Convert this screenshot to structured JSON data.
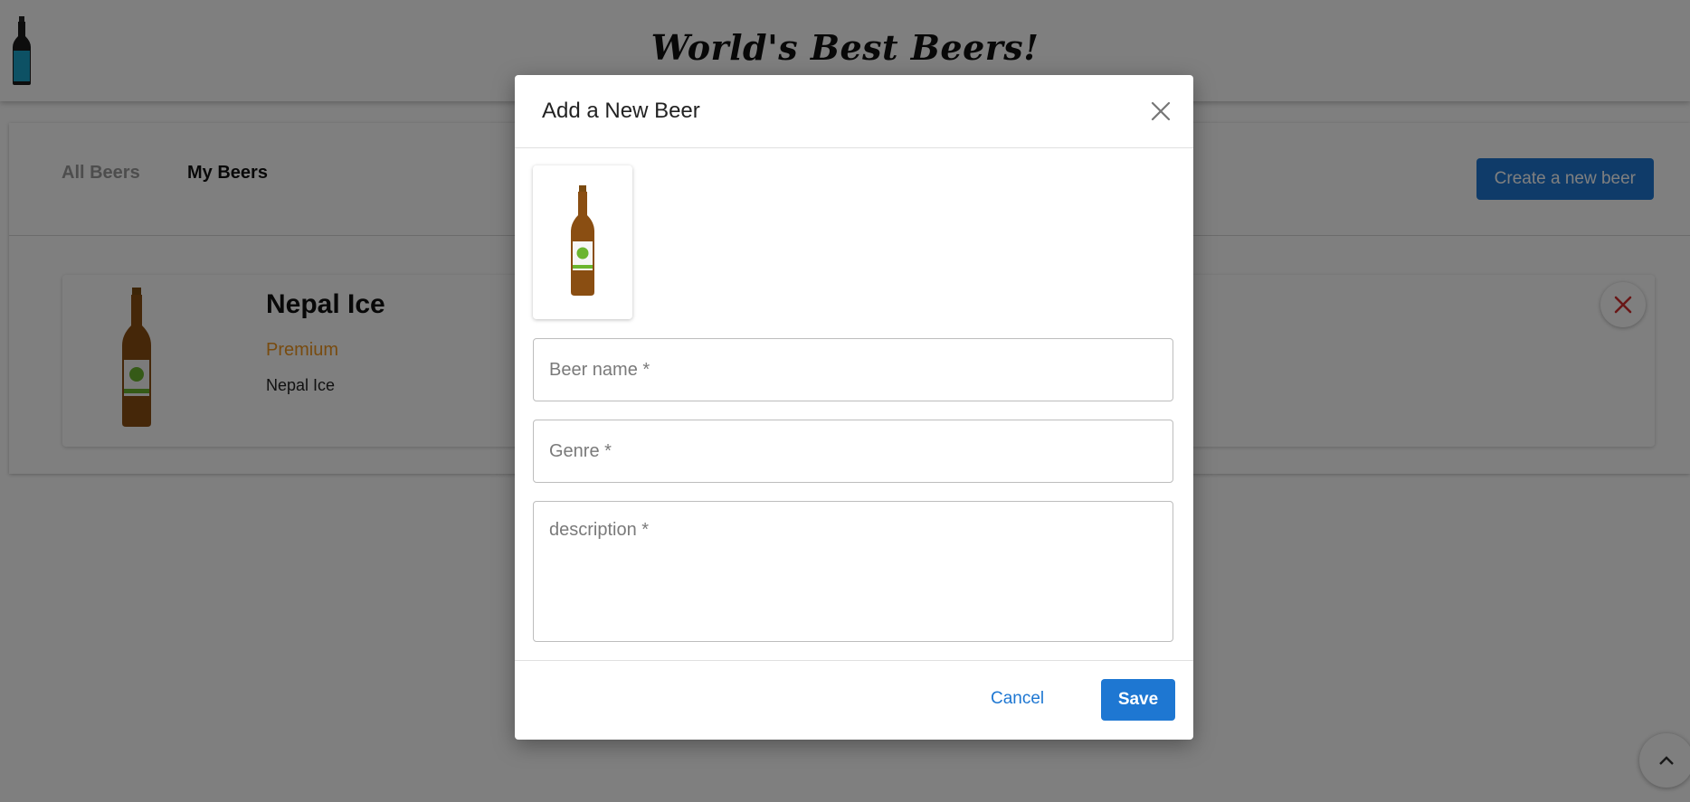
{
  "header": {
    "site_title": "World's Best Beers!",
    "logo_icon": "beer-bottle-icon"
  },
  "tabs": [
    {
      "label": "All Beers",
      "active": false
    },
    {
      "label": "My Beers",
      "active": true
    }
  ],
  "toolbar": {
    "create_label": "Create a new beer"
  },
  "beers": [
    {
      "name": "Nepal Ice",
      "genre": "Premium",
      "description": "Nepal Ice",
      "image_icon": "beer-bottle-icon",
      "delete_icon": "close-icon"
    }
  ],
  "modal": {
    "title": "Add a New Beer",
    "close_icon": "close-icon",
    "preview_icon": "beer-bottle-icon",
    "fields": {
      "name": {
        "placeholder": "Beer name *",
        "value": ""
      },
      "genre": {
        "placeholder": "Genre *",
        "value": ""
      },
      "description": {
        "placeholder": "description *",
        "value": ""
      }
    },
    "cancel_label": "Cancel",
    "save_label": "Save"
  },
  "scroll_top_icon": "chevron-up-icon",
  "colors": {
    "primary": "#1e77d2",
    "genre": "#f0961e",
    "delete": "#d32f2f",
    "overlay": "rgba(0,0,0,0.5)"
  }
}
